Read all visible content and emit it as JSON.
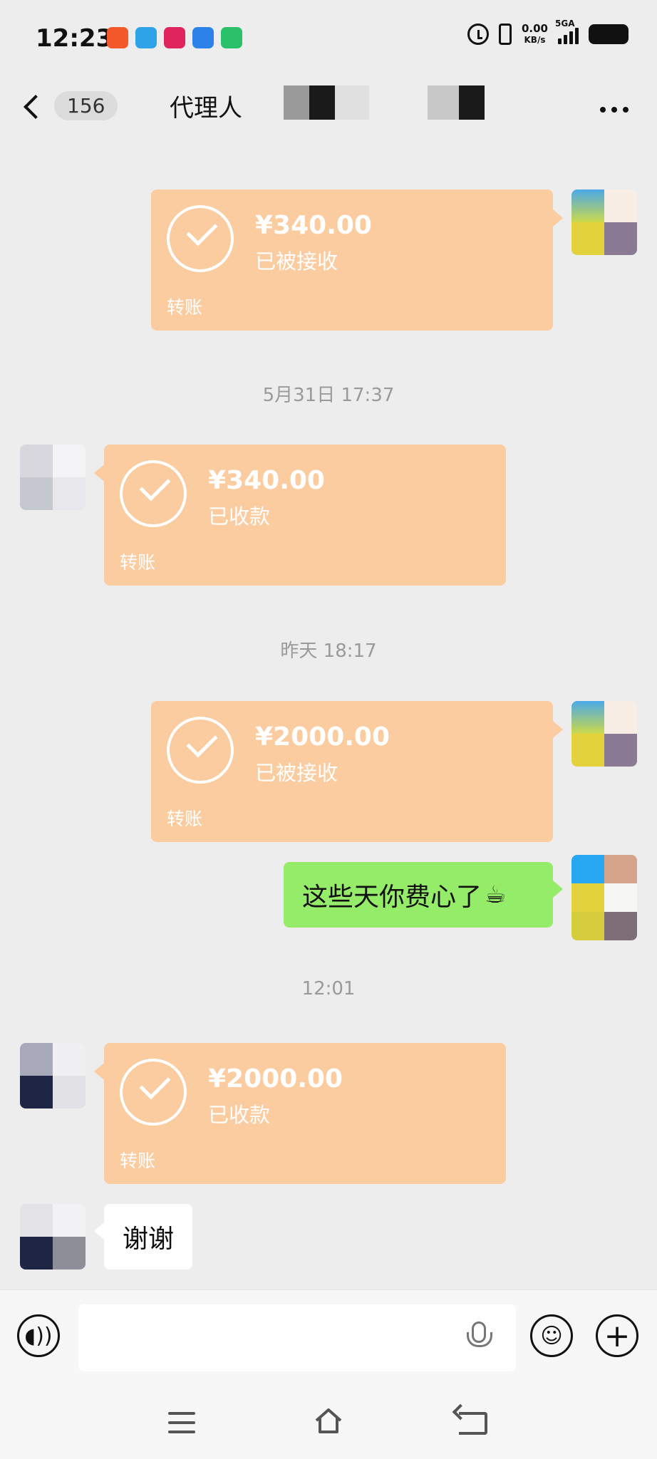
{
  "status_bar": {
    "time": "12:23",
    "net_speed_value": "0.00",
    "net_speed_unit": "KB/s",
    "network_type": "5GA",
    "app_icon_colors": [
      "#f4592b",
      "#2fa3e8",
      "#e0245e",
      "#2c82e8",
      "#2bc16b"
    ]
  },
  "header": {
    "unread_count": "156",
    "title_visible": "代理人",
    "more_icon": "ellipsis-icon",
    "back_icon": "chevron-left-icon"
  },
  "messages": [
    {
      "type": "transfer",
      "direction": "out",
      "amount": "¥340.00",
      "status": "已被接收",
      "label": "转账"
    },
    {
      "type": "timestamp",
      "text": "5月31日 17:37"
    },
    {
      "type": "transfer",
      "direction": "in",
      "amount": "¥340.00",
      "status": "已收款",
      "label": "转账"
    },
    {
      "type": "timestamp",
      "text": "昨天 18:17"
    },
    {
      "type": "transfer",
      "direction": "out",
      "amount": "¥2000.00",
      "status": "已被接收",
      "label": "转账"
    },
    {
      "type": "text",
      "direction": "out",
      "text": "这些天你费心了",
      "emoji": "☕"
    },
    {
      "type": "timestamp",
      "text": "12:01"
    },
    {
      "type": "transfer",
      "direction": "in",
      "amount": "¥2000.00",
      "status": "已收款",
      "label": "转账"
    },
    {
      "type": "text",
      "direction": "in",
      "text": "谢谢"
    }
  ],
  "input_bar": {
    "voice_icon": "voice-wave-icon",
    "mic_icon": "microphone-icon",
    "emoji_icon": "smiley-icon",
    "plus_icon": "plus-circle-icon",
    "placeholder": ""
  },
  "nav_bar": {
    "menu_icon": "menu-icon",
    "home_icon": "home-icon",
    "back_icon": "back-icon"
  },
  "colors": {
    "background": "#ededed",
    "transfer_card": "#fbcc9f",
    "outgoing_bubble": "#95ec69",
    "incoming_bubble": "#ffffff",
    "timestamp_text": "#9a9a9a"
  }
}
